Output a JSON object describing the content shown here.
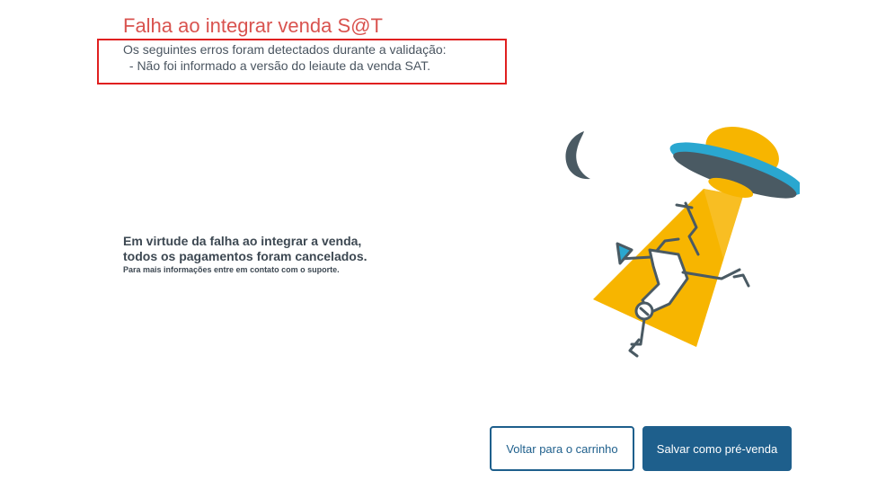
{
  "header": {
    "title": "Falha ao integrar venda S@T"
  },
  "errors": {
    "intro": "Os seguintes erros foram detectados durante a validação:",
    "items": [
      " - Não foi informado a versão do leiaute da venda SAT."
    ]
  },
  "message": {
    "line1": "Em virtude da falha ao integrar a venda,",
    "line2": "todos os pagamentos foram cancelados.",
    "support": "Para mais informações entre em contato com o suporte."
  },
  "illustration": {
    "icon": "ufo-abduction-illustration",
    "colors": {
      "beam": "#f7b500",
      "ufo_top": "#f7b500",
      "ufo_rim": "#2aa7d0",
      "ufo_dark": "#4a5a63",
      "moon": "#4a5a63"
    }
  },
  "actions": {
    "back_label": "Voltar para o carrinho",
    "save_label": "Salvar como pré-venda"
  },
  "colors": {
    "title": "#d9534f",
    "error_border": "#e02020",
    "primary": "#1e5f8c"
  }
}
